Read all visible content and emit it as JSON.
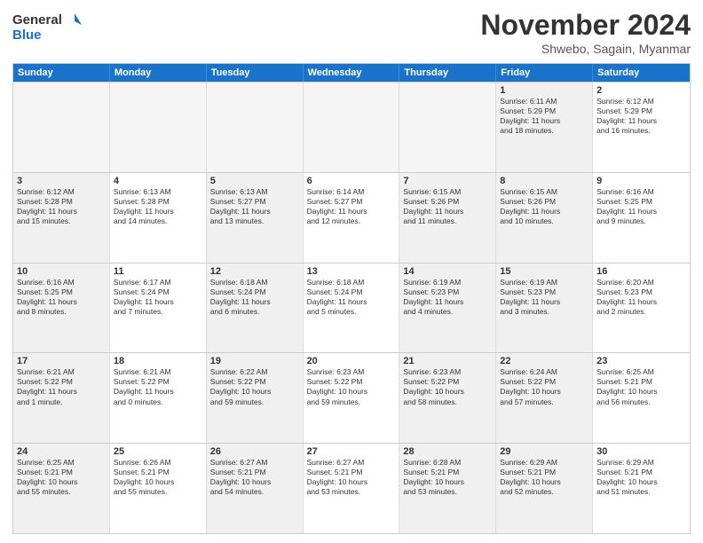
{
  "header": {
    "logo_line1": "General",
    "logo_line2": "Blue",
    "month": "November 2024",
    "location": "Shwebo, Sagain, Myanmar"
  },
  "days_of_week": [
    "Sunday",
    "Monday",
    "Tuesday",
    "Wednesday",
    "Thursday",
    "Friday",
    "Saturday"
  ],
  "rows": [
    [
      {
        "day": "",
        "detail": "",
        "empty": true
      },
      {
        "day": "",
        "detail": "",
        "empty": true
      },
      {
        "day": "",
        "detail": "",
        "empty": true
      },
      {
        "day": "",
        "detail": "",
        "empty": true
      },
      {
        "day": "",
        "detail": "",
        "empty": true
      },
      {
        "day": "1",
        "detail": "Sunrise: 6:11 AM\nSunset: 5:29 PM\nDaylight: 11 hours\nand 18 minutes.",
        "shaded": true
      },
      {
        "day": "2",
        "detail": "Sunrise: 6:12 AM\nSunset: 5:29 PM\nDaylight: 11 hours\nand 16 minutes.",
        "shaded": false
      }
    ],
    [
      {
        "day": "3",
        "detail": "Sunrise: 6:12 AM\nSunset: 5:28 PM\nDaylight: 11 hours\nand 15 minutes.",
        "shaded": true
      },
      {
        "day": "4",
        "detail": "Sunrise: 6:13 AM\nSunset: 5:28 PM\nDaylight: 11 hours\nand 14 minutes."
      },
      {
        "day": "5",
        "detail": "Sunrise: 6:13 AM\nSunset: 5:27 PM\nDaylight: 11 hours\nand 13 minutes.",
        "shaded": true
      },
      {
        "day": "6",
        "detail": "Sunrise: 6:14 AM\nSunset: 5:27 PM\nDaylight: 11 hours\nand 12 minutes."
      },
      {
        "day": "7",
        "detail": "Sunrise: 6:15 AM\nSunset: 5:26 PM\nDaylight: 11 hours\nand 11 minutes.",
        "shaded": true
      },
      {
        "day": "8",
        "detail": "Sunrise: 6:15 AM\nSunset: 5:26 PM\nDaylight: 11 hours\nand 10 minutes.",
        "shaded": true
      },
      {
        "day": "9",
        "detail": "Sunrise: 6:16 AM\nSunset: 5:25 PM\nDaylight: 11 hours\nand 9 minutes."
      }
    ],
    [
      {
        "day": "10",
        "detail": "Sunrise: 6:16 AM\nSunset: 5:25 PM\nDaylight: 11 hours\nand 8 minutes.",
        "shaded": true
      },
      {
        "day": "11",
        "detail": "Sunrise: 6:17 AM\nSunset: 5:24 PM\nDaylight: 11 hours\nand 7 minutes."
      },
      {
        "day": "12",
        "detail": "Sunrise: 6:18 AM\nSunset: 5:24 PM\nDaylight: 11 hours\nand 6 minutes.",
        "shaded": true
      },
      {
        "day": "13",
        "detail": "Sunrise: 6:18 AM\nSunset: 5:24 PM\nDaylight: 11 hours\nand 5 minutes."
      },
      {
        "day": "14",
        "detail": "Sunrise: 6:19 AM\nSunset: 5:23 PM\nDaylight: 11 hours\nand 4 minutes.",
        "shaded": true
      },
      {
        "day": "15",
        "detail": "Sunrise: 6:19 AM\nSunset: 5:23 PM\nDaylight: 11 hours\nand 3 minutes.",
        "shaded": true
      },
      {
        "day": "16",
        "detail": "Sunrise: 6:20 AM\nSunset: 5:23 PM\nDaylight: 11 hours\nand 2 minutes."
      }
    ],
    [
      {
        "day": "17",
        "detail": "Sunrise: 6:21 AM\nSunset: 5:22 PM\nDaylight: 11 hours\nand 1 minute.",
        "shaded": true
      },
      {
        "day": "18",
        "detail": "Sunrise: 6:21 AM\nSunset: 5:22 PM\nDaylight: 11 hours\nand 0 minutes."
      },
      {
        "day": "19",
        "detail": "Sunrise: 6:22 AM\nSunset: 5:22 PM\nDaylight: 10 hours\nand 59 minutes.",
        "shaded": true
      },
      {
        "day": "20",
        "detail": "Sunrise: 6:23 AM\nSunset: 5:22 PM\nDaylight: 10 hours\nand 59 minutes."
      },
      {
        "day": "21",
        "detail": "Sunrise: 6:23 AM\nSunset: 5:22 PM\nDaylight: 10 hours\nand 58 minutes.",
        "shaded": true
      },
      {
        "day": "22",
        "detail": "Sunrise: 6:24 AM\nSunset: 5:22 PM\nDaylight: 10 hours\nand 57 minutes.",
        "shaded": true
      },
      {
        "day": "23",
        "detail": "Sunrise: 6:25 AM\nSunset: 5:21 PM\nDaylight: 10 hours\nand 56 minutes."
      }
    ],
    [
      {
        "day": "24",
        "detail": "Sunrise: 6:25 AM\nSunset: 5:21 PM\nDaylight: 10 hours\nand 55 minutes.",
        "shaded": true
      },
      {
        "day": "25",
        "detail": "Sunrise: 6:26 AM\nSunset: 5:21 PM\nDaylight: 10 hours\nand 55 minutes."
      },
      {
        "day": "26",
        "detail": "Sunrise: 6:27 AM\nSunset: 5:21 PM\nDaylight: 10 hours\nand 54 minutes.",
        "shaded": true
      },
      {
        "day": "27",
        "detail": "Sunrise: 6:27 AM\nSunset: 5:21 PM\nDaylight: 10 hours\nand 53 minutes."
      },
      {
        "day": "28",
        "detail": "Sunrise: 6:28 AM\nSunset: 5:21 PM\nDaylight: 10 hours\nand 53 minutes.",
        "shaded": true
      },
      {
        "day": "29",
        "detail": "Sunrise: 6:29 AM\nSunset: 5:21 PM\nDaylight: 10 hours\nand 52 minutes.",
        "shaded": true
      },
      {
        "day": "30",
        "detail": "Sunrise: 6:29 AM\nSunset: 5:21 PM\nDaylight: 10 hours\nand 51 minutes."
      }
    ]
  ]
}
